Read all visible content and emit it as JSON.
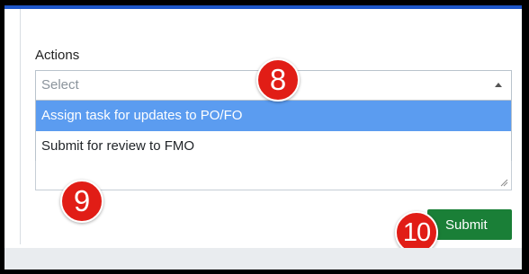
{
  "form": {
    "actions_label": "Actions",
    "select_placeholder": "Select",
    "options": [
      "Assign task for updates to PO/FO",
      "Submit for review to FMO"
    ],
    "highlighted_option_index": 0,
    "submit_label": "Submit"
  },
  "annotations": {
    "step_8": "8",
    "step_9": "9",
    "step_10": "10"
  },
  "colors": {
    "accent_top_bar": "#1e56c8",
    "option_highlight": "#5b9cf0",
    "submit_button": "#1a7f37",
    "step_badge": "#e11d16"
  }
}
